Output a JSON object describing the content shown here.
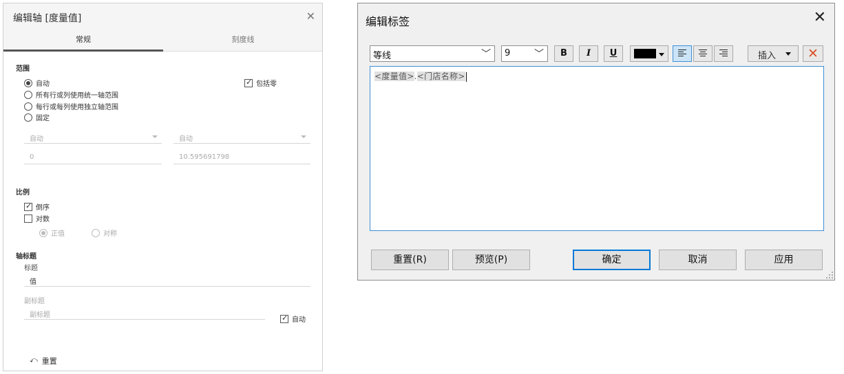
{
  "axis_panel": {
    "title": "编辑轴 [度量值]",
    "tabs": [
      {
        "label": "常规"
      },
      {
        "label": "刻度线"
      }
    ],
    "range": {
      "heading": "范围",
      "options": [
        {
          "label": "自动",
          "selected": true
        },
        {
          "label": "所有行或列使用统一轴范围",
          "selected": false
        },
        {
          "label": "每行或每列使用独立轴范围",
          "selected": false
        },
        {
          "label": "固定",
          "selected": false
        }
      ],
      "include_zero_label": "包括零",
      "include_zero_checked": true,
      "start_dropdown": "自动",
      "end_dropdown": "自动",
      "start_value": "0",
      "end_value": "10.595691798"
    },
    "scale": {
      "heading": "比例",
      "reversed_label": "倒序",
      "reversed_checked": true,
      "log_label": "对数",
      "log_checked": false,
      "positive_label": "正值",
      "symmetric_label": "对称"
    },
    "axis_titles": {
      "heading": "轴标题",
      "title_label": "标题",
      "title_value": "值",
      "subtitle_label": "副标题",
      "subtitle_placeholder": "副标题",
      "auto_label": "自动",
      "auto_checked": true
    },
    "reset_label": "重置",
    "reset_icon": "undo-icon"
  },
  "label_dialog": {
    "title": "编辑标签",
    "font_name": "等线",
    "font_size": "9",
    "bold_label": "B",
    "italic_label": "I",
    "underline_label": "U",
    "text_color": "#000000",
    "insert_label": "插入",
    "clear_icon": "close-x-icon",
    "editor": {
      "token1": "<度量值>",
      "separator": ".",
      "token2": "<门店名称>"
    },
    "buttons": {
      "reset": "重置(R)",
      "preview": "预览(P)",
      "ok": "确定",
      "cancel": "取消",
      "apply": "应用"
    }
  }
}
